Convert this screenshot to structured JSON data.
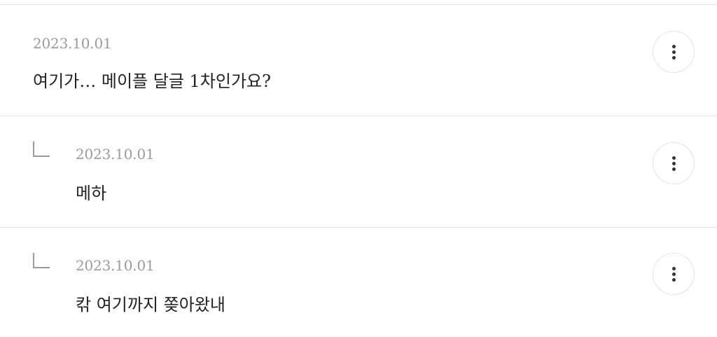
{
  "comments": [
    {
      "date": "2023.10.01",
      "text": "여기가… 메이플 달글 1차인가요?",
      "is_reply": false,
      "more_icon": "more-vertical-icon"
    },
    {
      "date": "2023.10.01",
      "text": "메하",
      "is_reply": true,
      "reply_icon": "reply-arrow-icon",
      "more_icon": "more-vertical-icon"
    },
    {
      "date": "2023.10.01",
      "text": "칶 여기까지 쫒아왔내",
      "is_reply": true,
      "reply_icon": "reply-arrow-icon",
      "more_icon": "more-vertical-icon"
    }
  ],
  "colors": {
    "date": "#9a9a9a",
    "text": "#222222",
    "divider": "#e6e6e6"
  }
}
